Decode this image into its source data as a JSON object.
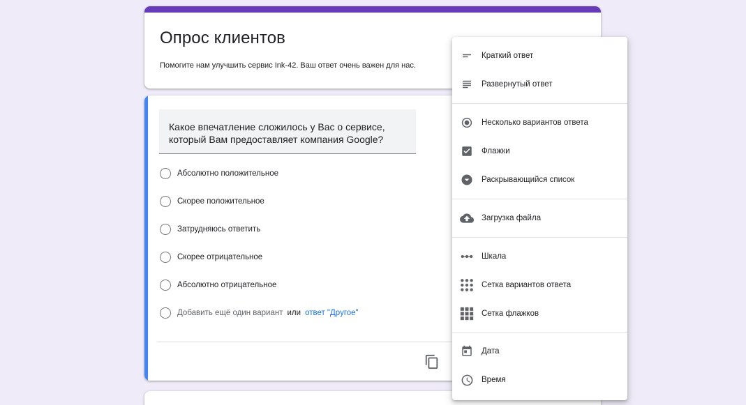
{
  "colors": {
    "background": "#efebf8",
    "header_accent": "#673ab7",
    "question_accent": "#4285f4",
    "link": "#1a73e8",
    "icon": "#5f6368"
  },
  "form": {
    "title": "Опрос клиентов",
    "description": "Помогите нам улучшить сервис Ink-42. Ваш ответ очень важен для нас."
  },
  "question": {
    "text": "Какое впечатление сложилось у Вас о сервисе, который Вам предоставляет компания Google?",
    "options": [
      "Абсолютно положительное",
      "Скорее положительное",
      "Затрудняюсь ответить",
      "Скорее отрицательное",
      "Абсолютно отрицательное"
    ],
    "add_option": "Добавить ещё один вариант",
    "or_text": "или",
    "add_other": "ответ \"Другое\""
  },
  "type_menu": {
    "items": [
      {
        "label": "Краткий ответ",
        "icon": "short-answer-icon"
      },
      {
        "label": "Развернутый ответ",
        "icon": "paragraph-icon"
      },
      {
        "label": "Несколько вариантов ответа",
        "icon": "radio-button-icon"
      },
      {
        "label": "Флажки",
        "icon": "checkbox-icon"
      },
      {
        "label": "Раскрывающийся список",
        "icon": "dropdown-icon"
      },
      {
        "label": "Загрузка файла",
        "icon": "cloud-upload-icon"
      },
      {
        "label": "Шкала",
        "icon": "linear-scale-icon"
      },
      {
        "label": "Сетка вариантов ответа",
        "icon": "multiple-choice-grid-icon"
      },
      {
        "label": "Сетка флажков",
        "icon": "checkbox-grid-icon"
      },
      {
        "label": "Дата",
        "icon": "calendar-icon"
      },
      {
        "label": "Время",
        "icon": "clock-icon"
      }
    ]
  }
}
